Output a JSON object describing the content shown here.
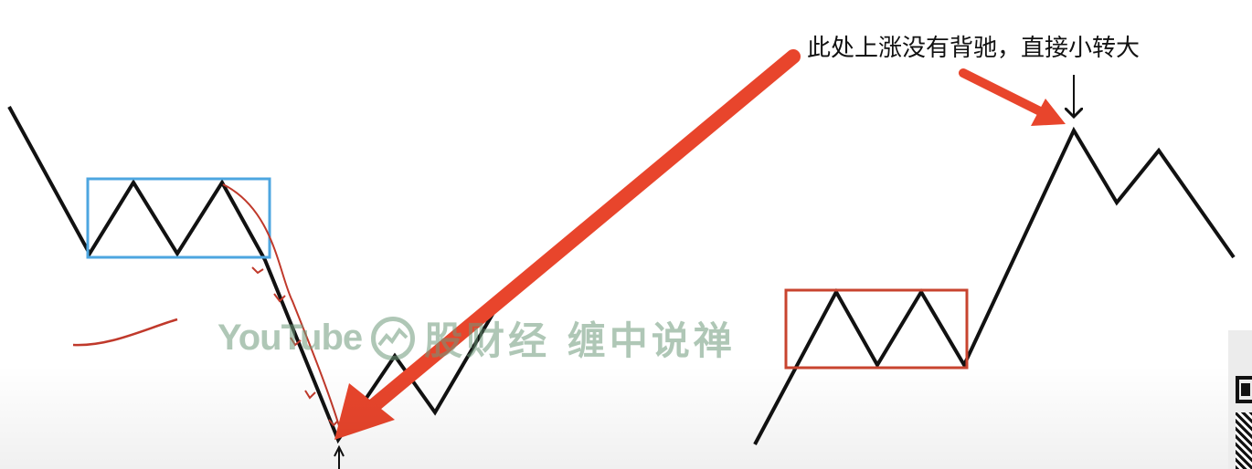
{
  "annotation": {
    "text": "此处上涨没有背驰，直接小转大"
  },
  "watermark": {
    "platform": "YouTube",
    "channel": "股财经 缠中说禅",
    "color": "#6f9a7c"
  },
  "colors": {
    "line": "#111111",
    "blue_box": "#4da6e0",
    "red_box": "#c8442f",
    "red_arrow": "#e8452c",
    "handwriting": "#c0392b"
  }
}
